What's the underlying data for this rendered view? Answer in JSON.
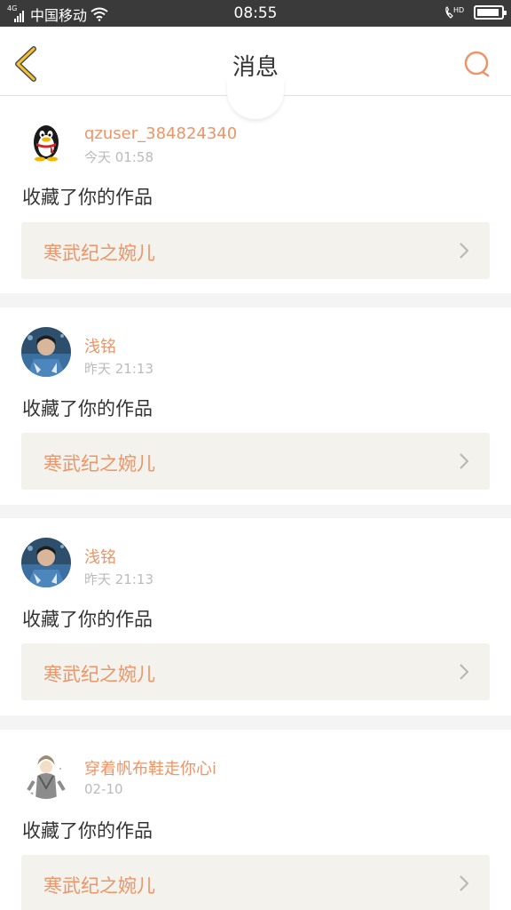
{
  "status_bar": {
    "signal_label": "4G",
    "carrier": "中国移动",
    "time": "08:55",
    "hd_label": "HD"
  },
  "header": {
    "title": "消息"
  },
  "colors": {
    "accent": "#ee9466",
    "back_arrow": "#f2c230",
    "card_link_bg": "#f3f2ec"
  },
  "messages": [
    {
      "username": "qzuser_384824340",
      "time": "今天 01:58",
      "action": "收藏了你的作品",
      "work_title": "寒武纪之婉儿",
      "avatar": "qq-penguin"
    },
    {
      "username": "浅铭",
      "time": "昨天 21:13",
      "action": "收藏了你的作品",
      "work_title": "寒武纪之婉儿",
      "avatar": "person-photo"
    },
    {
      "username": "浅铭",
      "time": "昨天 21:13",
      "action": "收藏了你的作品",
      "work_title": "寒武纪之婉儿",
      "avatar": "person-photo"
    },
    {
      "username": "穿着帆布鞋走你心i",
      "time": "02-10",
      "action": "收藏了你的作品",
      "work_title": "寒武纪之婉儿",
      "avatar": "anime-character"
    }
  ]
}
